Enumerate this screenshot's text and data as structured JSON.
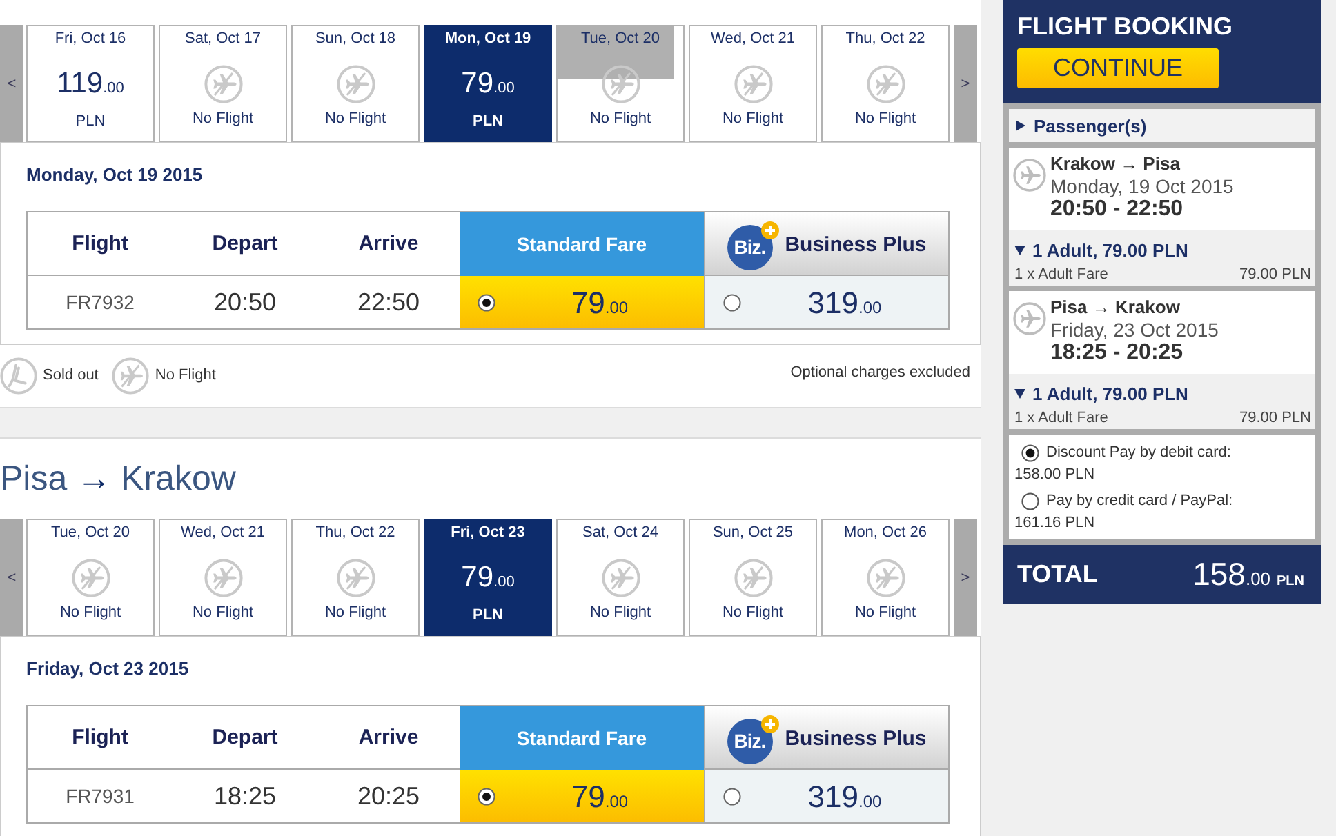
{
  "outbound": {
    "dates_prev": "<",
    "dates_next": ">",
    "dates": [
      {
        "date": "Fri, Oct 16",
        "kind": "price",
        "price": "119",
        "decimals": ".00",
        "currency": "PLN",
        "selected": false,
        "shaded": false
      },
      {
        "date": "Sat, Oct 17",
        "kind": "no_flight",
        "label": "No Flight",
        "selected": false,
        "shaded": false
      },
      {
        "date": "Sun, Oct 18",
        "kind": "no_flight",
        "label": "No Flight",
        "selected": false,
        "shaded": false
      },
      {
        "date": "Mon, Oct 19",
        "kind": "price",
        "price": "79",
        "decimals": ".00",
        "currency": "PLN",
        "selected": true,
        "shaded": false
      },
      {
        "date": "Tue, Oct 20",
        "kind": "no_flight",
        "label": "No Flight",
        "selected": false,
        "shaded": true
      },
      {
        "date": "Wed, Oct 21",
        "kind": "no_flight",
        "label": "No Flight",
        "selected": false,
        "shaded": false
      },
      {
        "date": "Thu, Oct 22",
        "kind": "no_flight",
        "label": "No Flight",
        "selected": false,
        "shaded": false
      }
    ],
    "day_title": "Monday, Oct 19 2015",
    "table": {
      "columns": [
        {
          "label": "Flight",
          "kind": "plain"
        },
        {
          "label": "Depart",
          "kind": "plain"
        },
        {
          "label": "Arrive",
          "kind": "plain"
        },
        {
          "label": "Standard Fare",
          "kind": "standard"
        },
        {
          "label": "Business Plus",
          "kind": "business",
          "logo": "Biz."
        }
      ],
      "rows": [
        {
          "flight": "FR7932",
          "depart": "20:50",
          "arrive": "22:50",
          "fares": [
            {
              "kind": "standard",
              "price": "79",
              "decimals": ".00",
              "selected": true
            },
            {
              "kind": "business",
              "price": "319",
              "decimals": ".00",
              "selected": false
            }
          ]
        }
      ]
    }
  },
  "legend": {
    "items": [
      {
        "kind": "sold_out",
        "label": "Sold out"
      },
      {
        "kind": "no_flight",
        "label": "No Flight"
      }
    ],
    "note": "Optional charges excluded"
  },
  "return": {
    "title": "Pisa **→** Krakow",
    "dates_prev": "<",
    "dates_next": ">",
    "dates": [
      {
        "date": "Tue, Oct 20",
        "kind": "no_flight",
        "label": "No Flight",
        "selected": false,
        "shaded": false
      },
      {
        "date": "Wed, Oct 21",
        "kind": "no_flight",
        "label": "No Flight",
        "selected": false,
        "shaded": false
      },
      {
        "date": "Thu, Oct 22",
        "kind": "no_flight",
        "label": "No Flight",
        "selected": false,
        "shaded": false
      },
      {
        "date": "Fri, Oct 23",
        "kind": "price",
        "price": "79",
        "decimals": ".00",
        "currency": "PLN",
        "selected": true,
        "shaded": false
      },
      {
        "date": "Sat, Oct 24",
        "kind": "no_flight",
        "label": "No Flight",
        "selected": false,
        "shaded": false
      },
      {
        "date": "Sun, Oct 25",
        "kind": "no_flight",
        "label": "No Flight",
        "selected": false,
        "shaded": false
      },
      {
        "date": "Mon, Oct 26",
        "kind": "no_flight",
        "label": "No Flight",
        "selected": false,
        "shaded": false
      }
    ],
    "day_title": "Friday, Oct 23 2015",
    "table": {
      "columns": [
        {
          "label": "Flight",
          "kind": "plain"
        },
        {
          "label": "Depart",
          "kind": "plain"
        },
        {
          "label": "Arrive",
          "kind": "plain"
        },
        {
          "label": "Standard Fare",
          "kind": "standard"
        },
        {
          "label": "Business Plus",
          "kind": "business",
          "logo": "Biz."
        }
      ],
      "rows": [
        {
          "flight": "FR7931",
          "depart": "18:25",
          "arrive": "20:25",
          "fares": [
            {
              "kind": "standard",
              "price": "79",
              "decimals": ".00",
              "selected": true
            },
            {
              "kind": "business",
              "price": "319",
              "decimals": ".00",
              "selected": false
            }
          ]
        }
      ]
    }
  },
  "sidebar": {
    "title": "FLIGHT BOOKING",
    "button": "CONTINUE",
    "passengers": {
      "label": "Passenger(s)",
      "expanded": false
    },
    "flights": [
      {
        "route": "Krakow → Pisa",
        "date": "Monday, 19 Oct 2015",
        "times": "20:50 - 22:50",
        "fare": {
          "summary": "1 Adult, 79.00 PLN",
          "expanded": true,
          "lines": [
            {
              "label": "1 x Adult Fare",
              "amount": "79.00 PLN"
            }
          ]
        }
      },
      {
        "route": "Pisa → Krakow",
        "date": "Friday, 23 Oct 2015",
        "times": "18:25 - 20:25",
        "fare": {
          "summary": "1 Adult, 79.00 PLN",
          "expanded": true,
          "lines": [
            {
              "label": "1 x Adult Fare",
              "amount": "79.00 PLN"
            }
          ]
        }
      }
    ],
    "payment": [
      {
        "label": "Discount Pay by debit card:",
        "amount": "158.00 PLN",
        "selected": true
      },
      {
        "label": "Pay by credit card / PayPal:",
        "amount": "161.16 PLN",
        "selected": false
      }
    ],
    "total": {
      "label": "TOTAL",
      "amount": "158",
      "decimals": ".00",
      "currency": "PLN"
    }
  }
}
